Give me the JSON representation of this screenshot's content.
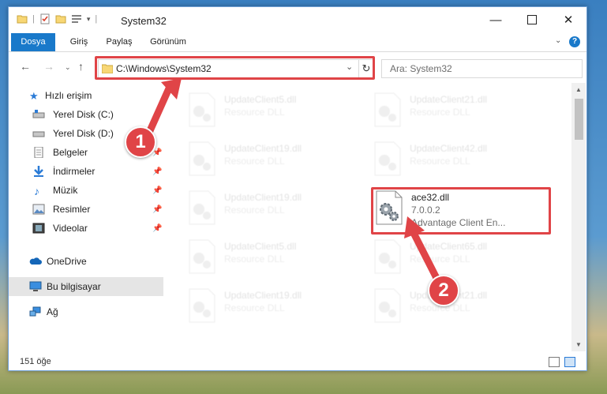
{
  "window": {
    "title": "System32"
  },
  "ribbon": {
    "tabs": [
      "Dosya",
      "Giriş",
      "Paylaş",
      "Görünüm"
    ]
  },
  "address": {
    "path": "C:\\Windows\\System32"
  },
  "search": {
    "placeholder": "Ara: System32"
  },
  "sidebar": {
    "items": [
      {
        "label": "Hızlı erişim",
        "icon": "star-icon"
      },
      {
        "label": "Yerel Disk (C:)",
        "icon": "drive-icon"
      },
      {
        "label": "Yerel Disk (D:)",
        "icon": "drive-icon"
      },
      {
        "label": "Belgeler",
        "icon": "document-icon"
      },
      {
        "label": "İndirmeler",
        "icon": "download-icon"
      },
      {
        "label": "Müzik",
        "icon": "music-icon"
      },
      {
        "label": "Resimler",
        "icon": "picture-icon"
      },
      {
        "label": "Videolar",
        "icon": "video-icon"
      },
      {
        "label": "OneDrive",
        "icon": "cloud-icon"
      },
      {
        "label": "Bu bilgisayar",
        "icon": "computer-icon"
      },
      {
        "label": "Ağ",
        "icon": "network-icon"
      }
    ]
  },
  "files": [
    {
      "name": "UpdateClient5.dll",
      "desc": "Resource DLL"
    },
    {
      "name": "UpdateClient21.dll",
      "desc": "Resource DLL"
    },
    {
      "name": "UpdateClient19.dll",
      "desc": "Resource DLL"
    },
    {
      "name": "UpdateClient42.dll",
      "desc": "Resource DLL"
    },
    {
      "name": "UpdateClient19.dll",
      "desc": "Resource DLL"
    },
    {
      "name": "ace32.dll",
      "version": "7.0.0.2",
      "desc": "Advantage Client En..."
    },
    {
      "name": "UpdateClient5.dll",
      "desc": "Resource DLL"
    },
    {
      "name": "UpdateClient65.dll",
      "desc": "Resource DLL"
    },
    {
      "name": "UpdateClient19.dll",
      "desc": "Resource DLL"
    },
    {
      "name": "UpdateClient21.dll",
      "desc": "Resource DLL"
    }
  ],
  "status": {
    "count": "151 öğe"
  },
  "callouts": {
    "one": "1",
    "two": "2"
  },
  "colors": {
    "accent": "#1979ca",
    "highlight": "#e04447"
  }
}
